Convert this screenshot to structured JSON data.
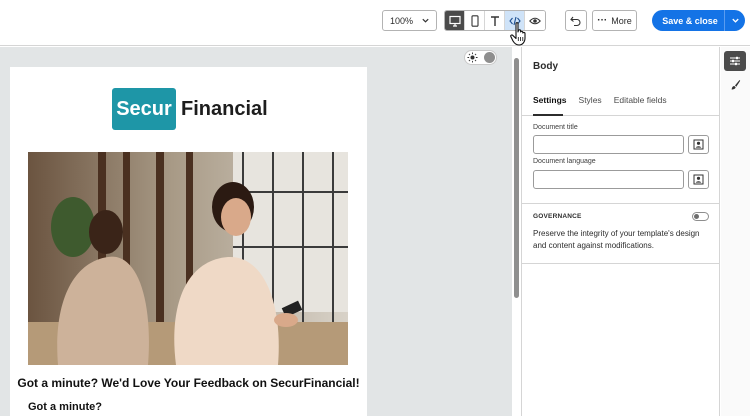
{
  "toolbar": {
    "zoom": "100%",
    "view_buttons": [
      "desktop-view",
      "mobile-view",
      "text-view",
      "code-view",
      "preview"
    ],
    "more_label": "More",
    "save_label": "Save & close"
  },
  "email": {
    "logo_box_text": "Secur",
    "logo_text": "Financial",
    "headline": "Got a minute? We'd Love Your Feedback on SecurFinancial!",
    "subhead": "Got a minute?"
  },
  "panel": {
    "title": "Body",
    "tabs": [
      "Settings",
      "Styles",
      "Editable fields"
    ],
    "active_tab": "Settings",
    "document_title_label": "Document title",
    "document_title_value": "",
    "document_language_label": "Document language",
    "document_language_value": "",
    "governance_title": "GOVERNANCE",
    "governance_desc": "Preserve the integrity of your template's design and content against modifications."
  },
  "colors": {
    "accent": "#1473e6",
    "logo_teal": "#1e96a7",
    "selected_view": "#4b4b4b",
    "hover_view": "#cfe3f8"
  }
}
